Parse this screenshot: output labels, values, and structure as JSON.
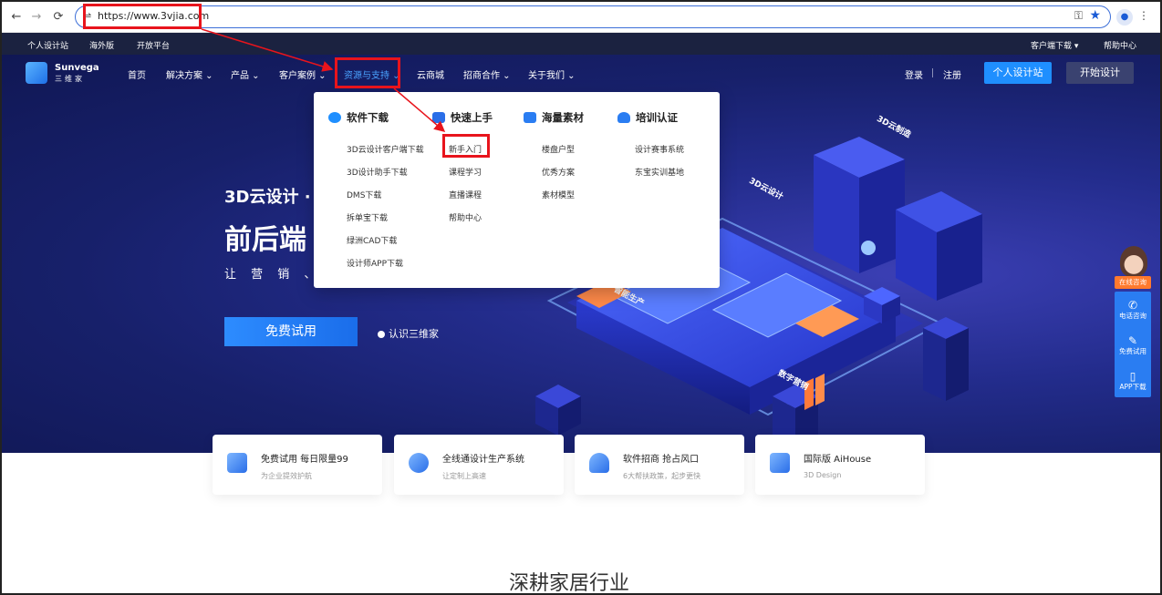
{
  "browser": {
    "url": "https://www.3vjia.com"
  },
  "topbar": {
    "left_links": [
      "个人设计站",
      "海外版",
      "开放平台"
    ],
    "client_download": "客户端下载 ▾",
    "help_center": "帮助中心"
  },
  "nav": {
    "logo_name": "Sunvega",
    "logo_sub": "三维家",
    "items": [
      "首页",
      "解决方案 ⌄",
      "产品 ⌄",
      "客户案例 ⌄",
      "资源与支持 ⌄",
      "云商城",
      "招商合作 ⌄",
      "关于我们 ⌄"
    ],
    "active_index": 4,
    "login": "登录",
    "register": "注册",
    "personal_btn": "个人设计站",
    "start_btn": "开始设计"
  },
  "hero": {
    "title": "3D云设计 ·",
    "big_title": "前后端",
    "subtitle": "让 营 销 、 设",
    "trial_btn": "免费试用",
    "know_link": "认识三维家"
  },
  "illustration": {
    "signs": [
      "3D云制造",
      "3D云设计",
      "智能生产",
      "数字营销"
    ]
  },
  "dropdown": {
    "columns": [
      {
        "heading": "软件下载",
        "icon_color": "#1f8fff",
        "items": [
          "3D云设计客户端下载",
          "3D设计助手下载",
          "DMS下载",
          "拆单宝下载",
          "绿洲CAD下载",
          "设计师APP下载"
        ]
      },
      {
        "heading": "快速上手",
        "icon_color": "#2a6ee8",
        "items": [
          "新手入门",
          "课程学习",
          "直播课程",
          "帮助中心"
        ]
      },
      {
        "heading": "海量素材",
        "icon_color": "#2a7df2",
        "items": [
          "楼盘户型",
          "优秀方案",
          "素材模型"
        ]
      },
      {
        "heading": "培训认证",
        "icon_color": "#2a7df2",
        "items": [
          "设计赛事系统",
          "东宝实训基地"
        ]
      }
    ]
  },
  "float": {
    "consult": "在线咨询",
    "items": [
      {
        "icon": "phone-icon",
        "label": "电话咨询"
      },
      {
        "icon": "edit-icon",
        "label": "免费试用"
      },
      {
        "icon": "mobile-icon",
        "label": "APP下载"
      }
    ]
  },
  "cards": [
    {
      "title": "免费试用 每日限量99",
      "sub": "为企业提效护航"
    },
    {
      "title": "全线通设计生产系统",
      "sub": "让定制上高速"
    },
    {
      "title": "软件招商 抢占风口",
      "sub": "6大帮扶政策，起步更快"
    },
    {
      "title": "国际版 AiHouse",
      "sub": "3D Design"
    }
  ],
  "section_title": "深耕家居行业",
  "colors": {
    "accent": "#1f8fff",
    "annotation": "#e8141c"
  }
}
